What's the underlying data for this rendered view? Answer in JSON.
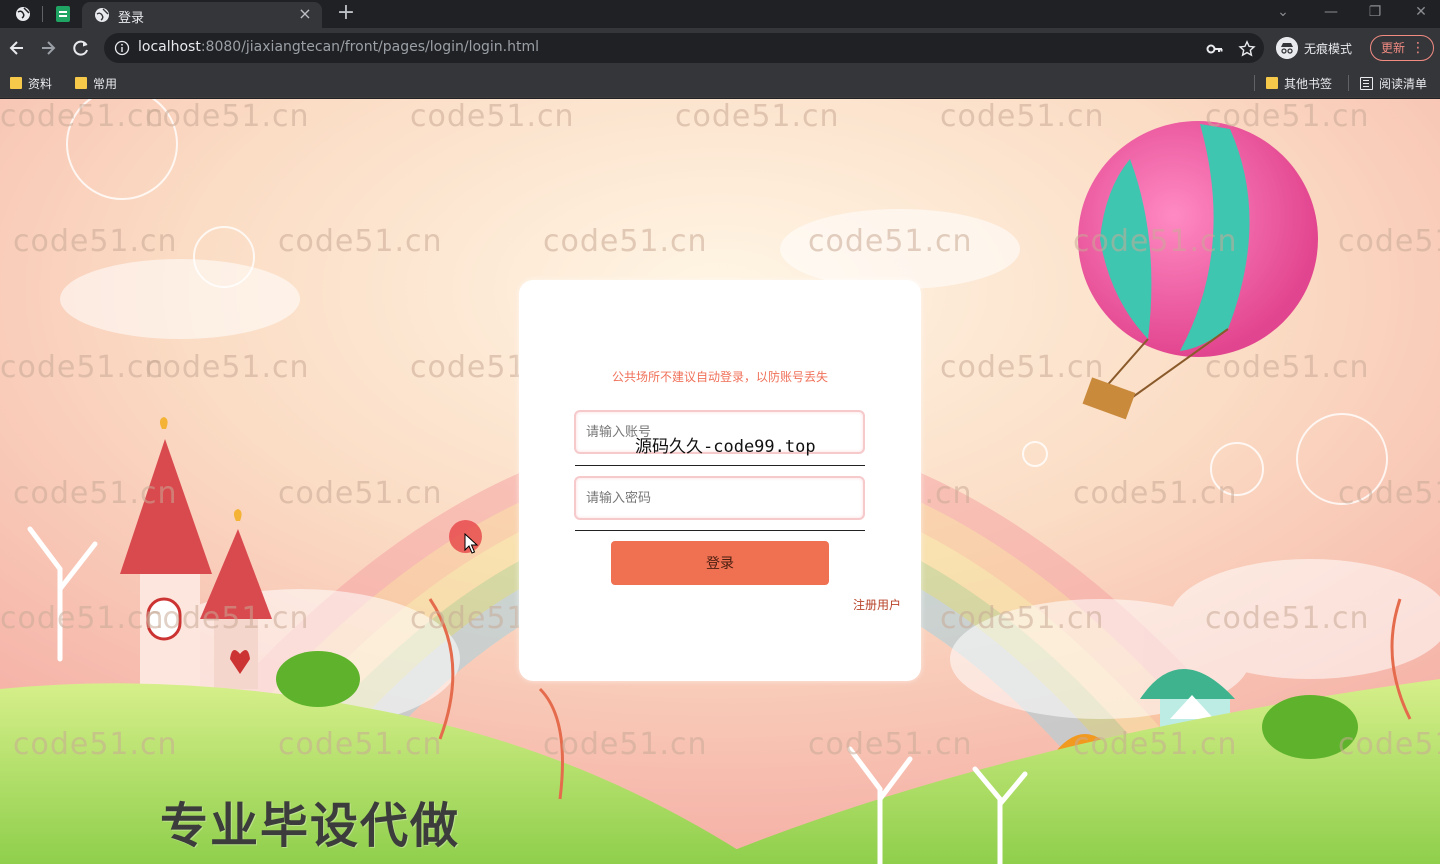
{
  "browser": {
    "tab": {
      "title": "登录",
      "close": "×"
    },
    "new_tab": "+",
    "window_controls": {
      "dropdown": "⌄",
      "minimize": "—",
      "restore": "❐",
      "close": "✕"
    },
    "address": {
      "host": "localhost",
      "path": ":8080/jiaxiangtecan/front/pages/login/login.html"
    },
    "incognito_label": "无痕模式",
    "update_label": "更新",
    "bookmarks": {
      "left": [
        "资料",
        "常用"
      ],
      "other": "其他书签",
      "reading_list": "阅读清单"
    },
    "icons": {
      "back": "back-arrow-icon",
      "forward": "forward-arrow-icon",
      "reload": "reload-icon",
      "key": "key-icon",
      "star": "star-icon"
    }
  },
  "watermark": {
    "text": "code51.cn"
  },
  "login": {
    "notice": "公共场所不建议自动登录，以防账号丢失",
    "username_placeholder": "请输入账号",
    "password_placeholder": "请输入密码",
    "submit_label": "登录",
    "register_label": "注册用户",
    "accent_color": "#ef7152"
  },
  "overlay": {
    "text": "源码久久-code99.top"
  },
  "promo": {
    "text": "专业毕设代做"
  }
}
